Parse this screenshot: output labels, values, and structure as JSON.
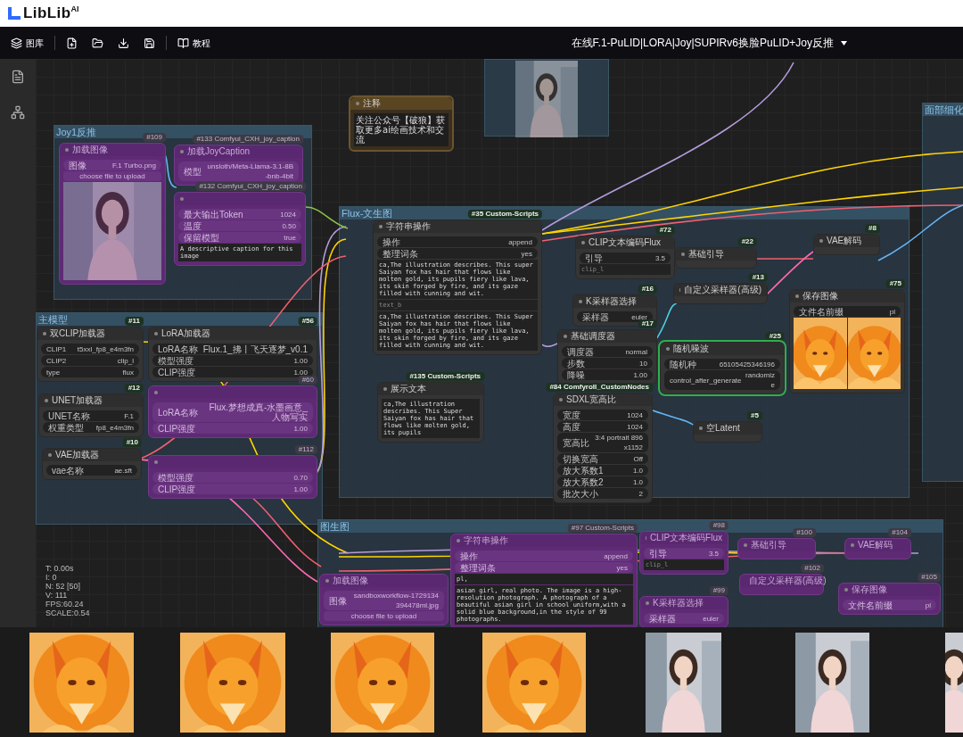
{
  "header": {
    "logo": "LibLib",
    "logo_sup": "AI"
  },
  "toolbar": {
    "library": "图库",
    "tutorial": "教程",
    "workflow_title": "在线F.1-PuLID|LORA|Joy|SUPIRv6换脸PuLID+Joy反推"
  },
  "groups": [
    {
      "title": "Joy1反推"
    },
    {
      "title": "主模型"
    },
    {
      "title": "Flux-文生图"
    },
    {
      "title": "图生图"
    },
    {
      "title": "面部细化"
    }
  ],
  "nodes": [
    {
      "title": "加载图像",
      "badge": "#109",
      "bypassed": true,
      "selected": false,
      "widgets": [
        {
          "label": "图像",
          "value": "F.1 Turbo.png"
        }
      ],
      "button": "choose file to upload"
    },
    {
      "title": "加载JoyCaption",
      "badge": "#133 Comfyui_CXH_joy_caption",
      "bypassed": true,
      "selected": false,
      "widgets": [
        {
          "label": "模型",
          "value": "unsloth/Meta-Llama-3.1-8B-bnb-4bit"
        }
      ]
    },
    {
      "badge": "#132 Comfyui_CXH_joy_caption",
      "bypassed": true,
      "selected": false,
      "texts": [
        {
          "text": "A descriptive caption for this image"
        }
      ],
      "widgets": [
        {
          "label": "最大输出Token",
          "value": "1024"
        },
        {
          "label": "温度",
          "value": "0.50"
        },
        {
          "label": "保留模型",
          "value": "true"
        }
      ]
    },
    {
      "title": "注释",
      "kind": "note",
      "bypassed": false,
      "selected": false,
      "texts": [
        {
          "text": "关注公众号【破狼】获取更多ai绘画技术和交流"
        }
      ]
    },
    {
      "title": "字符串操作",
      "badge": "#35 Custom-Scripts",
      "bypassed": false,
      "selected": false,
      "widgets": [
        {
          "label": "操作",
          "value": "append"
        },
        {
          "label": "整理词条",
          "value": "yes"
        }
      ],
      "texts": [
        {
          "text": "ca,The illustration describes. This super Saiyan fox has hair that flows like molten gold, its pupils fiery like lava, its skin forged by fire, and its gaze filled with cunning and wit."
        },
        {
          "placeholder": "text_b"
        },
        {
          "text": "ca,The illustration describes. This Super Saiyan fox has hair that flows like molten gold, its pupils fiery like lava, its skin forged by fire, and its gaze filled with cunning and wit."
        }
      ]
    },
    {
      "title": "展示文本",
      "badge": "#135 Custom-Scripts",
      "bypassed": false,
      "selected": false,
      "texts": [
        {
          "text": "ca,The illustration describes. This Super Saiyan fox has hair that flows like molten gold, its pupils"
        }
      ]
    },
    {
      "title": "CLIP文本编码Flux",
      "badge": "#72",
      "bypassed": false,
      "selected": false,
      "texts": [
        {
          "placeholder": "clip_l"
        }
      ],
      "widgets": [
        {
          "label": "引导",
          "value": "3.5"
        }
      ]
    },
    {
      "title": "K采样器选择",
      "badge": "#16",
      "bypassed": false,
      "selected": false,
      "widgets": [
        {
          "label": "采样器",
          "value": "euler"
        }
      ]
    },
    {
      "title": "基础调度器",
      "badge": "#17",
      "bypassed": false,
      "selected": false,
      "widgets": [
        {
          "label": "调度器",
          "value": "normal"
        },
        {
          "label": "步数",
          "value": "10"
        },
        {
          "label": "降噪",
          "value": "1.00"
        }
      ]
    },
    {
      "title": "SDXL宽高比",
      "badge": "#84 ComfyroII_CustomNodes",
      "bypassed": false,
      "selected": false,
      "widgets": [
        {
          "label": "宽度",
          "value": "1024"
        },
        {
          "label": "高度",
          "value": "1024"
        },
        {
          "label": "宽高比",
          "value": "3:4 portrait 896x1152"
        },
        {
          "label": "切换宽高",
          "value": "Off"
        },
        {
          "label": "放大系数1",
          "value": "1.0"
        },
        {
          "label": "放大系数2",
          "value": "1.0"
        },
        {
          "label": "批次大小",
          "value": "2"
        }
      ]
    },
    {
      "title": "基础引导",
      "badge": "#22",
      "bypassed": false,
      "selected": false
    },
    {
      "title": "自定义采样器(高级)",
      "badge": "#13",
      "bypassed": false,
      "selected": false
    },
    {
      "title": "随机噪波",
      "badge": "#25",
      "bypassed": false,
      "selected": true,
      "widgets": [
        {
          "label": "随机种",
          "value": "65105425346196"
        },
        {
          "label": "control_after_generate",
          "value": "randomize"
        }
      ]
    },
    {
      "title": "空Latent",
      "badge": "#5",
      "bypassed": false,
      "selected": false
    },
    {
      "title": "VAE解码",
      "badge": "#8",
      "bypassed": false,
      "selected": false
    },
    {
      "title": "保存图像",
      "badge": "#75",
      "bypassed": false,
      "selected": false,
      "widgets": [
        {
          "label": "文件名前缀",
          "value": "pl"
        }
      ]
    },
    {
      "title": "双CLIP加载器",
      "badge": "#11",
      "bypassed": false,
      "selected": false,
      "widgets": [
        {
          "label": "CLIP1",
          "value": "t5xxl_fp8_e4m3fn"
        },
        {
          "label": "CLIP2",
          "value": "clip_l"
        },
        {
          "label": "type",
          "value": "flux"
        }
      ]
    },
    {
      "title": "UNET加载器",
      "badge": "#12",
      "bypassed": false,
      "selected": false,
      "widgets": [
        {
          "label": "UNET名称",
          "value": "F.1"
        },
        {
          "label": "权重类型",
          "value": "fp8_e4m3fn"
        }
      ]
    },
    {
      "title": "VAE加载器",
      "badge": "#10",
      "bypassed": false,
      "selected": false,
      "widgets": [
        {
          "label": "vae名称",
          "value": "ae.sft"
        }
      ]
    },
    {
      "title": "LoRA加载器",
      "badge": "#56",
      "bypassed": false,
      "selected": false,
      "widgets": [
        {
          "label": "LoRA名称",
          "value": "Flux.1_拂丨飞天逐梦_v0.1"
        },
        {
          "label": "模型强度",
          "value": "1.00"
        },
        {
          "label": "CLIP强度",
          "value": "1.00"
        }
      ]
    },
    {
      "badge": "#60",
      "bypassed": true,
      "selected": false,
      "widgets": [
        {
          "label": "LoRA名称",
          "value": "Flux.梦想成真-水墨画意_人物写实"
        },
        {
          "label": "CLIP强度",
          "value": "1.00"
        }
      ]
    },
    {
      "badge": "#112",
      "bypassed": true,
      "selected": false,
      "widgets": [
        {
          "label": "模型强度",
          "value": "0.70"
        },
        {
          "label": "CLIP强度",
          "value": "1.00"
        }
      ]
    },
    {
      "title": "加载图像",
      "bypassed": true,
      "selected": false,
      "widgets": [
        {
          "label": "图像",
          "value": "sandboxworkflow-1729134394478ml.jpg"
        }
      ],
      "button": "choose file to upload"
    },
    {
      "title": "字符串操作",
      "badge": "#97 Custom-Scripts",
      "bypassed": true,
      "selected": false,
      "widgets": [
        {
          "label": "操作",
          "value": "append"
        },
        {
          "label": "整理词条",
          "value": "yes"
        }
      ],
      "texts": [
        {
          "text": "pl,"
        },
        {
          "text": "asian girl, real photo. The image is a high-resolution photograph. A photograph of a beautiful asian girl in school uniform,with a solid blue background,in the style of 99 photographs."
        }
      ]
    },
    {
      "title": "CLIP文本编码Flux",
      "badge": "#98",
      "bypassed": true,
      "selected": false,
      "texts": [
        {
          "placeholder": "clip_l"
        }
      ],
      "widgets": [
        {
          "label": "引导",
          "value": "3.5"
        }
      ]
    },
    {
      "title": "基础引导",
      "badge": "#100",
      "bypassed": true,
      "selected": false
    },
    {
      "title": "VAE解码",
      "badge": "#104",
      "bypassed": true,
      "selected": false
    },
    {
      "title": "自定义采样器(高级)",
      "badge": "#102",
      "bypassed": true,
      "selected": false
    },
    {
      "title": "K采样器选择",
      "badge": "#99",
      "bypassed": true,
      "selected": false,
      "widgets": [
        {
          "label": "采样器",
          "value": "euler"
        }
      ]
    },
    {
      "title": "保存图像",
      "badge": "#105",
      "bypassed": true,
      "selected": false,
      "widgets": [
        {
          "label": "文件名前缀",
          "value": "pl"
        }
      ]
    }
  ],
  "stats": [
    "T: 0.00s",
    "I: 0",
    "N: 52 [50]",
    "V: 111",
    "FPS:60.24",
    "SCALE:0.54"
  ],
  "gallery": [
    {
      "kind": "picture"
    },
    {
      "kind": "picture"
    },
    {
      "kind": "picture"
    },
    {
      "kind": "picture"
    },
    {
      "kind": "picture"
    },
    {
      "kind": "picture"
    },
    {
      "kind": "picture"
    }
  ]
}
